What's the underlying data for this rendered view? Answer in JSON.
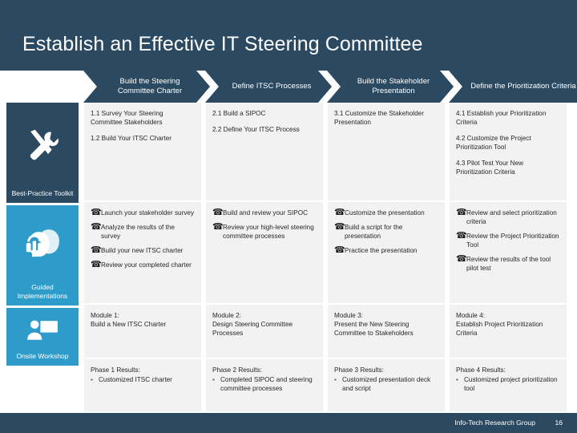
{
  "slide": {
    "title": "Establish an Effective IT Steering Committee",
    "brand_dark": "#2b4a61",
    "brand_blue": "#2d9cca",
    "cell_bg": "#f2f2f2"
  },
  "phases": [
    {
      "header": "Build the Steering Committee Charter"
    },
    {
      "header": "Define ITSC Processes"
    },
    {
      "header": "Build the Stakeholder Presentation"
    },
    {
      "header": "Define the Prioritization Criteria"
    }
  ],
  "rail": [
    {
      "label": "Best-Practice Toolkit",
      "icon": "tools-icon"
    },
    {
      "label": "Guided Implementations",
      "icon": "headset-people-icon"
    },
    {
      "label": "Onsite Workshop",
      "icon": "presenter-icon"
    }
  ],
  "steps": {
    "col1": [
      "1.1 Survey Your Steering Committee Stakeholders",
      "1.2 Build Your ITSC Charter"
    ],
    "col2": [
      "2.1 Build a SIPOC",
      "2.2 Define Your ITSC Process"
    ],
    "col3": [
      "3.1 Customize the Stakeholder Presentation"
    ],
    "col4": [
      "4.1 Establish your Prioritization Criteria",
      "4.2 Customize the Project Prioritization Tool",
      "4.3 Pilot Test Your New Prioritization Criteria"
    ]
  },
  "calls": {
    "icon": "phone-icon",
    "col1": [
      "Launch your stakeholder survey",
      "Analyze the results of the survey",
      "Build your new ITSC charter",
      "Review your completed charter"
    ],
    "col2": [
      "Build and review your SIPOC",
      "Review your high-level steering committee processes"
    ],
    "col3": [
      "Customize the presentation",
      "Build a script for the presentation",
      "Practice the presentation"
    ],
    "col4": [
      "Review and select prioritization criteria",
      "Review the Project Prioritization Tool",
      "Review the results of the tool pilot test"
    ]
  },
  "modules": {
    "col1": "Module 1:\nBuild a New ITSC Charter",
    "col2": "Module 2:\nDesign Steering Committee Processes",
    "col3": "Module 3:\nPresent the New Steering Committee to Stakeholders",
    "col4": "Module 4:\nEstablish Project Prioritization Criteria"
  },
  "phase_results": {
    "bullet": "▪",
    "col1": {
      "title": "Phase 1 Results:",
      "items": [
        "Customized ITSC charter"
      ]
    },
    "col2": {
      "title": "Phase 2 Results:",
      "items": [
        "Completed SIPOC and steering committee processes"
      ]
    },
    "col3": {
      "title": "Phase 3 Results:",
      "items": [
        "Customized presentation deck and script"
      ]
    },
    "col4": {
      "title": "Phase 4 Results:",
      "items": [
        "Customized project prioritization tool"
      ]
    }
  },
  "footer": {
    "organization": "Info-Tech Research Group",
    "page_number": "16"
  }
}
